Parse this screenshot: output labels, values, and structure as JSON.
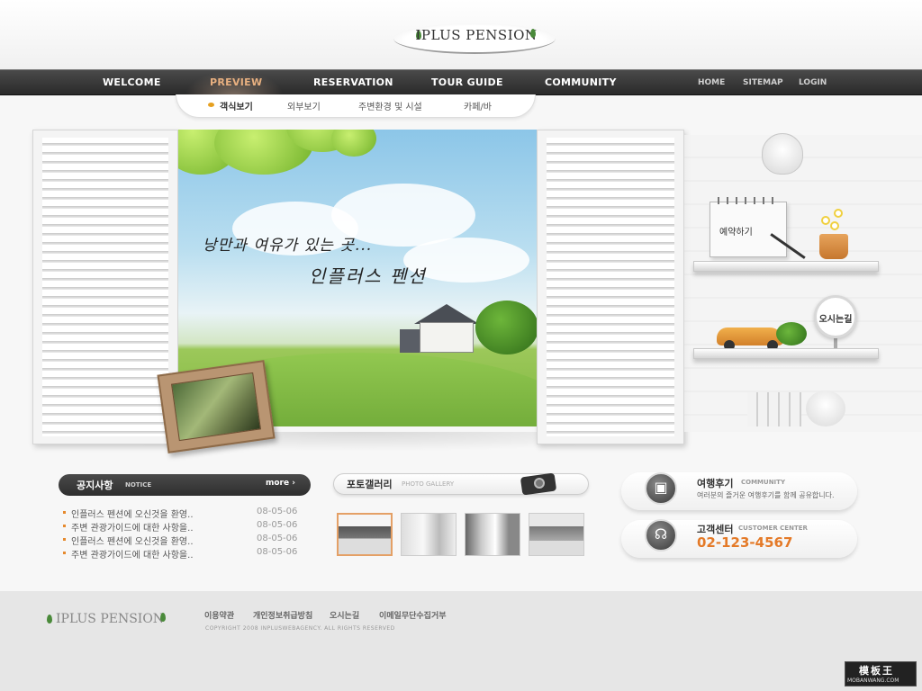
{
  "brand": {
    "name": "IPLUS PENSION"
  },
  "nav": {
    "main": [
      "WELCOME",
      "PREVIEW",
      "RESERVATION",
      "TOUR GUIDE",
      "COMMUNITY"
    ],
    "active": "PREVIEW",
    "utility": [
      "HOME",
      "SITEMAP",
      "LOGIN"
    ]
  },
  "subnav": {
    "items": [
      "객식보기",
      "외부보기",
      "주변환경 및 시설",
      "카페/바"
    ],
    "active": "객식보기"
  },
  "hero": {
    "line1": "낭만과 여유가 있는 곳...",
    "line2": "인플러스 펜션"
  },
  "deco": {
    "reserve_label": "예약하기",
    "directions_label": "오시는길"
  },
  "notice": {
    "title": "공지사항",
    "subtitle": "NOTICE",
    "more": "more ›",
    "items": [
      {
        "text": "인플러스 펜션에 오신것을 환영..",
        "date": "08-05-06"
      },
      {
        "text": "주변 관광가이드에 대한 사항을..",
        "date": "08-05-06"
      },
      {
        "text": "인플러스 펜션에 오신것을 환영..",
        "date": "08-05-06"
      },
      {
        "text": "주변 관광가이드에 대한 사항을..",
        "date": "08-05-06"
      }
    ]
  },
  "gallery": {
    "title": "포토갤러리",
    "subtitle": "PHOTO GALLERY"
  },
  "community": {
    "title": "여행후기",
    "subtitle": "COMMUNITY",
    "desc": "여러분의 즐거운 여행후기를 함께 공유합니다."
  },
  "customer": {
    "title": "고객센터",
    "subtitle": "CUSTOMER CENTER",
    "phone": "02-123-4567"
  },
  "footer": {
    "logo": "IPLUS PENSION",
    "links": [
      "이용약관",
      "개인정보취급방침",
      "오시는길",
      "이메일무단수집거부"
    ],
    "copyright": "COPYRIGHT 2008 INPLUSWEBAGENCY. ALL RIGHTS RESERVED"
  },
  "watermark": {
    "main": "模板王",
    "sub": "MOBANWANG.COM"
  },
  "colors": {
    "accent": "#e47a28",
    "nav_bg": "#333333",
    "active_nav": "#e8b080"
  }
}
